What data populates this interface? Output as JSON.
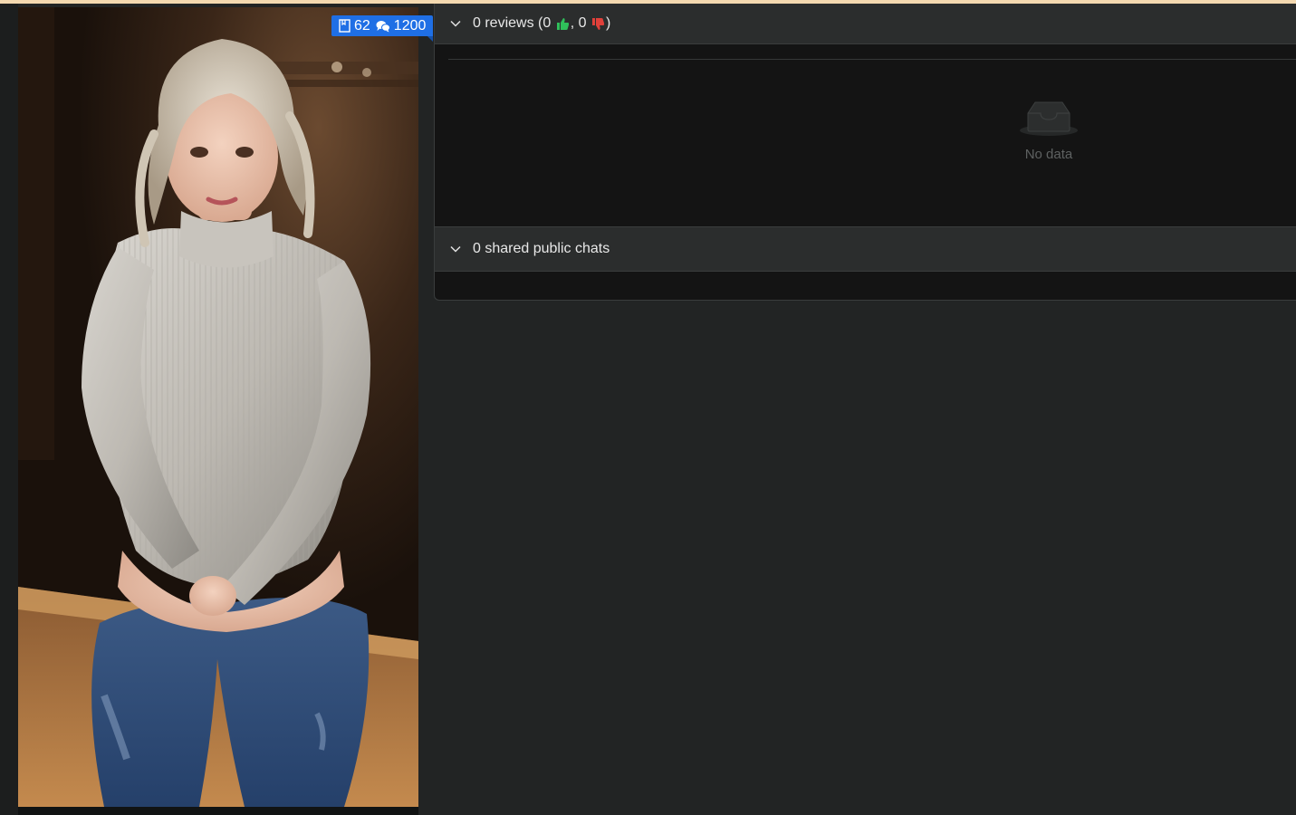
{
  "character_card": {
    "stats": {
      "messages_count": "62",
      "chats_count": "1200",
      "badge_color": "#1f6fe5"
    },
    "icons": {
      "messages": "bookmark-icon",
      "chats": "chat-bubbles-icon"
    }
  },
  "reviews_section": {
    "prefix": "0 reviews (0 ",
    "separator": ", 0 ",
    "suffix": ")",
    "empty_text": "No data",
    "icons": {
      "toggle": "chevron-down-icon",
      "thumb_up": "thumbs-up-icon",
      "thumb_down": "thumbs-down-icon",
      "empty": "inbox-icon"
    },
    "colors": {
      "thumb_up": "#2fbf5a",
      "thumb_down": "#e0403a"
    }
  },
  "shared_chats_section": {
    "label": "0 shared public chats",
    "icons": {
      "toggle": "chevron-down-icon"
    }
  },
  "theme": {
    "accent_top": "#f4d9b0",
    "panel_bg": "#141414",
    "header_bg": "#2b2d2d",
    "page_bg": "#222424"
  }
}
